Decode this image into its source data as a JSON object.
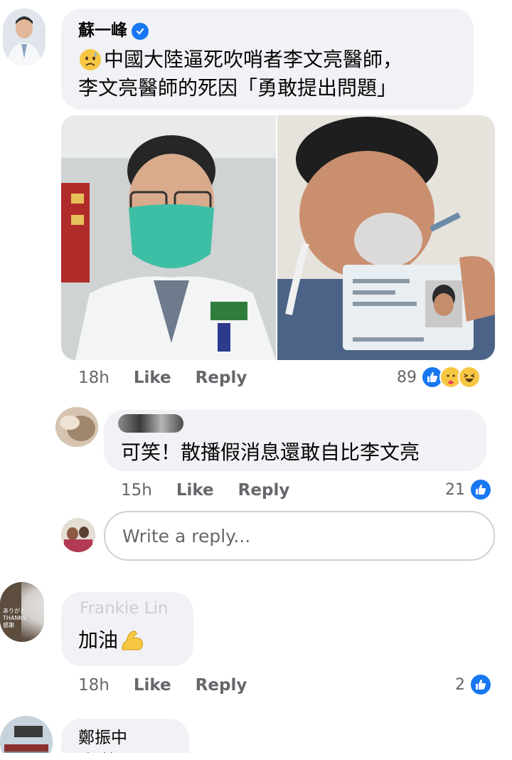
{
  "colors": {
    "accent": "#1877f2",
    "bubble_bg": "#f0f2f5",
    "meta_text": "#65676b"
  },
  "comment1": {
    "author": "蘇一峰",
    "verified": true,
    "line1": "中國大陸逼死吹哨者李文亮醫師，",
    "line2": "李文亮醫師的死因「勇敢提出問題」",
    "emoji": "worried-face-emoji",
    "time": "18h",
    "like_label": "Like",
    "reply_label": "Reply",
    "reaction_count": "89",
    "reactions": [
      "like",
      "care",
      "haha"
    ]
  },
  "reply1": {
    "author": "",
    "text": "可笑！散播假消息還敢自比李文亮",
    "time": "15h",
    "like_label": "Like",
    "reply_label": "Reply",
    "reaction_count": "21",
    "reactions": [
      "like"
    ]
  },
  "reply_box": {
    "placeholder": "Write a reply..."
  },
  "comment2": {
    "author": "Frankie Lin",
    "avatar_text": [
      "ありがと",
      "THANKS",
      "感謝"
    ],
    "text": "加油",
    "emoji": "flexed-biceps-emoji",
    "time": "18h",
    "like_label": "Like",
    "reply_label": "Reply",
    "reaction_count": "2",
    "reactions": [
      "like"
    ]
  },
  "comment3": {
    "author": "鄭振中",
    "text_partial": "商莫子！"
  }
}
